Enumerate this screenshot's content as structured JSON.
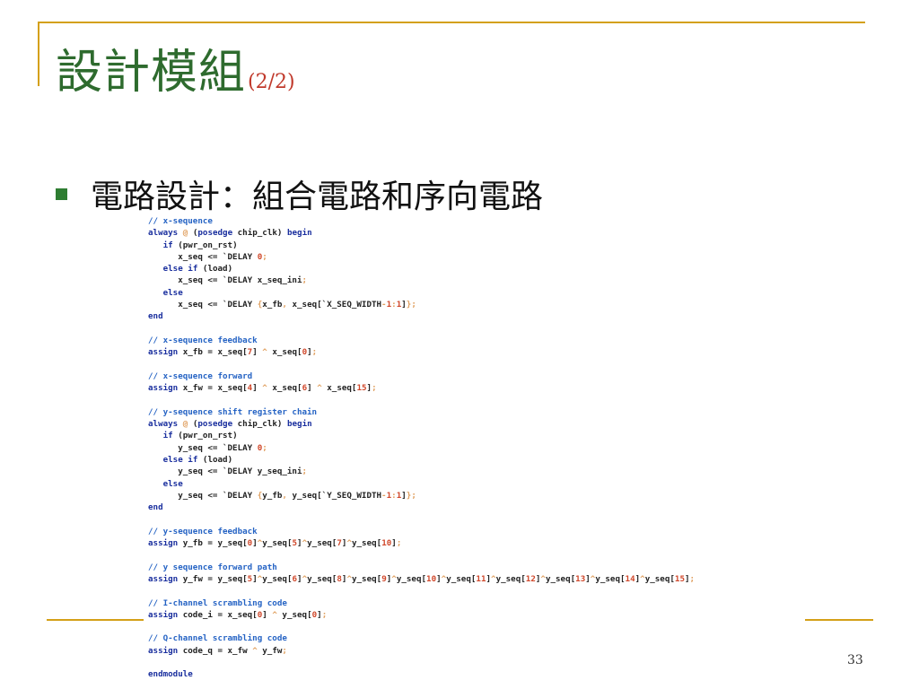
{
  "slide": {
    "title": "設計模組",
    "title_suffix": "(2/2)",
    "bullet": "電路設計：組合電路和序向電路",
    "page_number": "33",
    "colors": {
      "title_green": "#2e6b2e",
      "accent_gold": "#d4a017",
      "bullet_green": "#2e7d32",
      "comment_blue": "#2563c4",
      "keyword_navy": "#1a2f9e",
      "number_red": "#d0472a"
    }
  },
  "code_lines": [
    "// x-sequence",
    "always @ (posedge chip_clk) begin",
    "   if (pwr_on_rst)",
    "      x_seq <= `DELAY 0;",
    "   else if (load)",
    "      x_seq <= `DELAY x_seq_ini;",
    "   else",
    "      x_seq <= `DELAY {x_fb, x_seq[`X_SEQ_WIDTH-1:1]};",
    "end",
    "",
    "// x-sequence feedback",
    "assign x_fb = x_seq[7] ^ x_seq[0];",
    "",
    "// x-sequence forward",
    "assign x_fw = x_seq[4] ^ x_seq[6] ^ x_seq[15];",
    "",
    "// y-sequence shift register chain",
    "always @ (posedge chip_clk) begin",
    "   if (pwr_on_rst)",
    "      y_seq <= `DELAY 0;",
    "   else if (load)",
    "      y_seq <= `DELAY y_seq_ini;",
    "   else",
    "      y_seq <= `DELAY {y_fb, y_seq[`Y_SEQ_WIDTH-1:1]};",
    "end",
    "",
    "// y-sequence feedback",
    "assign y_fb = y_seq[0]^y_seq[5]^y_seq[7]^y_seq[10];",
    "",
    "// y sequence forward path",
    "assign y_fw = y_seq[5]^y_seq[6]^y_seq[8]^y_seq[9]^y_seq[10]^y_seq[11]^y_seq[12]^y_seq[13]^y_seq[14]^y_seq[15];",
    "",
    "// I-channel scrambling code",
    "assign code_i = x_seq[0] ^ y_seq[0];",
    "",
    "// Q-channel scrambling code",
    "assign code_q = x_fw ^ y_fw;",
    "",
    "endmodule"
  ]
}
